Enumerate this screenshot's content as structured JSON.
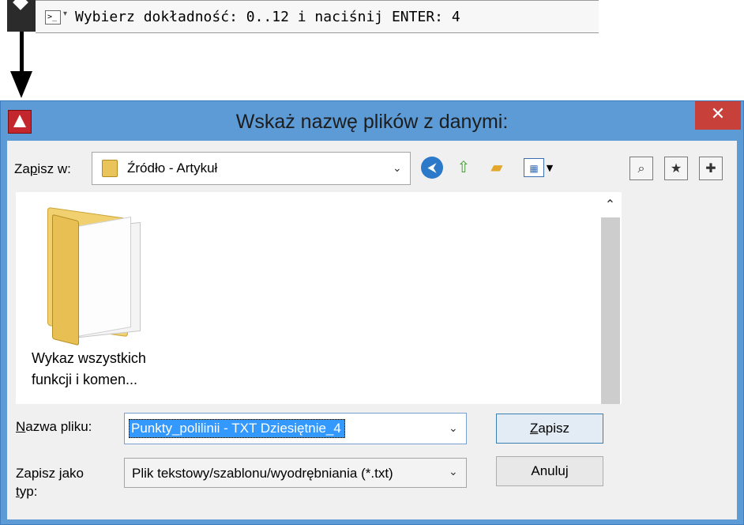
{
  "command_line": {
    "icon": "command-prompt-icon",
    "prompt": "Wybierz dokładność: 0..12 i naciśnij ENTER: 4"
  },
  "dialog": {
    "title": "Wskaż nazwę plików z danymi:",
    "close_glyph": "✕",
    "save_in_label_before": "Za",
    "save_in_label_accel": "p",
    "save_in_label_after": "isz w:",
    "location": "Źródło - Artykuł",
    "toolbar_icons": [
      "back-icon",
      "up-folder-icon",
      "new-folder-icon",
      "views-menu-icon"
    ],
    "right_icons": [
      "search-web-icon",
      "favorites-icon",
      "add-favorites-icon"
    ],
    "files": [
      {
        "name": "Wykaz wszystkich funkcji i komen...",
        "line1": "Wykaz wszystkich",
        "line2": "funkcji i komen...",
        "icon": "folder-icon"
      }
    ],
    "filename_label_accel": "N",
    "filename_label_rest": "azwa pliku:",
    "filename_value": "Punkty_polilinii - TXT Dziesiętnie_4",
    "filetype_label_line1": "Zapisz jako",
    "filetype_label_accel": "t",
    "filetype_label_line2_rest": "yp:",
    "filetype_value": "Plik tekstowy/szablonu/wyodrębniania (*.txt)",
    "save_button_accel": "Z",
    "save_button_rest": "apisz",
    "cancel_button": "Anuluj"
  },
  "colors": {
    "titlebar": "#5c9bd6",
    "close_button": "#c8403a",
    "selection": "#3399ff",
    "client": "#f0f0f0"
  }
}
